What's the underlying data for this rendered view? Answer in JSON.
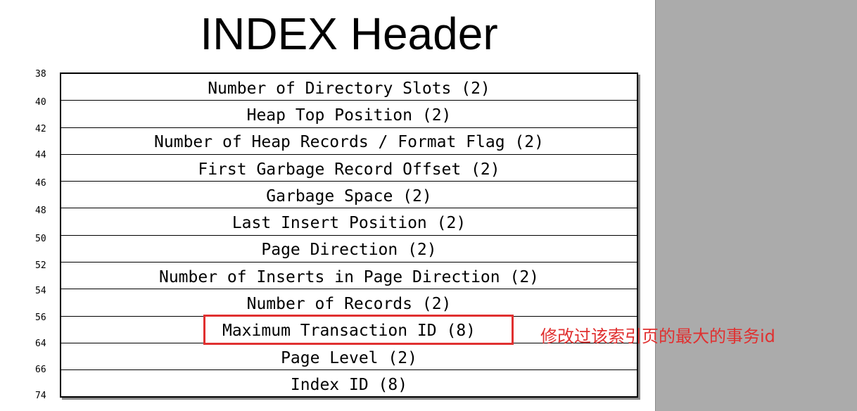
{
  "title": "INDEX Header",
  "offsets": [
    "38",
    "40",
    "42",
    "44",
    "46",
    "48",
    "50",
    "52",
    "54",
    "56",
    "64",
    "66",
    "74"
  ],
  "fields": [
    "Number of Directory Slots (2)",
    "Heap Top Position (2)",
    "Number of Heap Records / Format Flag (2)",
    "First Garbage Record Offset (2)",
    "Garbage Space (2)",
    "Last Insert Position (2)",
    "Page Direction (2)",
    "Number of Inserts in Page Direction (2)",
    "Number of Records (2)",
    "Maximum Transaction ID (8)",
    "Page Level (2)",
    "Index ID (8)"
  ],
  "annotation": {
    "text": "修改过该索引页的最大的事务id",
    "color": "#e03030",
    "highlighted_field": "Maximum Transaction ID (8)"
  }
}
